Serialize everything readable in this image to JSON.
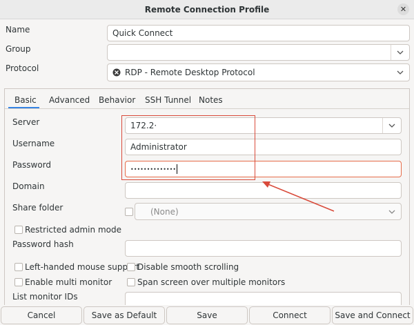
{
  "window": {
    "title": "Remote Connection Profile"
  },
  "profile": {
    "name_label": "Name",
    "name_value": "Quick Connect",
    "group_label": "Group",
    "group_value": "",
    "protocol_label": "Protocol",
    "protocol_value": "RDP - Remote Desktop Protocol"
  },
  "tabs": [
    {
      "label": "Basic",
      "active": true
    },
    {
      "label": "Advanced"
    },
    {
      "label": "Behavior"
    },
    {
      "label": "SSH Tunnel"
    },
    {
      "label": "Notes"
    }
  ],
  "basic": {
    "server_label": "Server",
    "server_value": "172.2·",
    "username_label": "Username",
    "username_value": "Administrator",
    "password_label": "Password",
    "password_value": "••••••••••••••",
    "domain_label": "Domain",
    "domain_value": "",
    "share_folder_label": "Share folder",
    "share_folder_value": "(None)",
    "restricted_admin_label": "Restricted admin mode",
    "password_hash_label": "Password hash",
    "password_hash_value": "",
    "left_handed_label": "Left-handed mouse support",
    "disable_smooth_label": "Disable smooth scrolling",
    "multi_monitor_label": "Enable multi monitor",
    "span_screen_label": "Span screen over multiple monitors",
    "list_monitor_label": "List monitor IDs",
    "list_monitor_value": ""
  },
  "buttons": {
    "cancel": "Cancel",
    "save_default": "Save as Default",
    "save": "Save",
    "connect": "Connect",
    "save_connect": "Save and Connect"
  },
  "annotation": {
    "color": "#d94a3a"
  },
  "colors": {
    "accent": "#3584e4",
    "focus": "#e66b48"
  }
}
